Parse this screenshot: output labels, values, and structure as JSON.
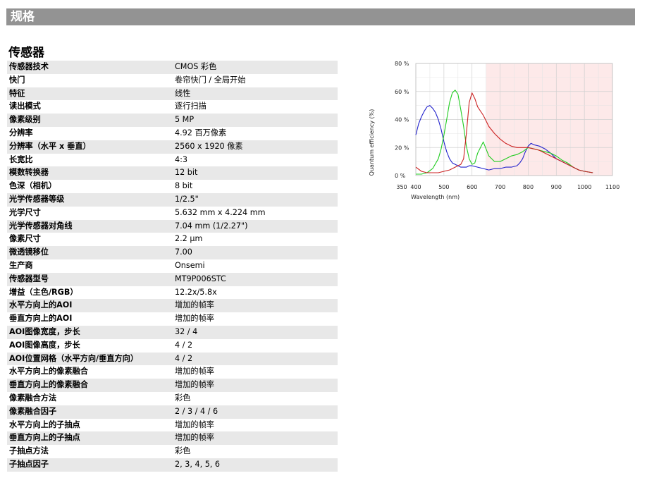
{
  "header": {
    "title": "规格"
  },
  "section": {
    "title": "传感器"
  },
  "specs": [
    {
      "key": "传感器技术",
      "value": "CMOS 彩色"
    },
    {
      "key": "快门",
      "value": "卷帘快门 / 全局开始"
    },
    {
      "key": "特征",
      "value": "线性"
    },
    {
      "key": "读出模式",
      "value": "逐行扫描"
    },
    {
      "key": "像素级别",
      "value": "5 MP"
    },
    {
      "key": "分辨率",
      "value": "4.92 百万像素"
    },
    {
      "key": "分辨率（水平 x 垂直）",
      "value": "2560 x 1920 像素"
    },
    {
      "key": "长宽比",
      "value": "4:3"
    },
    {
      "key": "模数转换器",
      "value": "12 bit"
    },
    {
      "key": "色深（相机）",
      "value": "8 bit"
    },
    {
      "key": "光学传感器等级",
      "value": "1/2.5\""
    },
    {
      "key": "光学尺寸",
      "value": "5.632 mm x 4.224 mm"
    },
    {
      "key": "光学传感器对角线",
      "value": "7.04 mm (1/2.27\")"
    },
    {
      "key": "像素尺寸",
      "value": "2.2 µm"
    },
    {
      "key": "微透镜移位",
      "value": "7.00"
    },
    {
      "key": "生产商",
      "value": "Onsemi"
    },
    {
      "key": "传感器型号",
      "value": "MT9P006STC"
    },
    {
      "key": "增益（主色/RGB）",
      "value": "12.2x/5.8x"
    },
    {
      "key": "水平方向上的AOI",
      "value": "增加的帧率"
    },
    {
      "key": "垂直方向上的AOI",
      "value": "增加的帧率"
    },
    {
      "key": "AOI图像宽度，步长",
      "value": "32 / 4"
    },
    {
      "key": "AOI图像高度，步长",
      "value": "4 / 2"
    },
    {
      "key": "AOI位置网格（水平方向/垂直方向）",
      "value": "4 / 2"
    },
    {
      "key": "水平方向上的像素融合",
      "value": "增加的帧率"
    },
    {
      "key": "垂直方向上的像素融合",
      "value": "增加的帧率"
    },
    {
      "key": "像素融合方法",
      "value": "彩色"
    },
    {
      "key": "像素融合因子",
      "value": "2 / 3 / 4 / 6"
    },
    {
      "key": "水平方向上的子抽点",
      "value": "增加的帧率"
    },
    {
      "key": "垂直方向上的子抽点",
      "value": "增加的帧率"
    },
    {
      "key": "子抽点方法",
      "value": "彩色"
    },
    {
      "key": "子抽点因子",
      "value": "2, 3, 4, 5, 6"
    }
  ],
  "chart_data": {
    "type": "line",
    "title": "",
    "xlabel": "Wavelength (nm)",
    "ylabel": "Quantum efficiency (%)",
    "xlim": [
      350,
      1100
    ],
    "ylim": [
      0,
      80
    ],
    "x_ticks": [
      350,
      400,
      500,
      600,
      700,
      800,
      900,
      1000,
      1100
    ],
    "x_tick_labels": [
      "350",
      "400",
      "500",
      "600",
      "700",
      "800",
      "900",
      "1000",
      "1100"
    ],
    "y_ticks": [
      0,
      20,
      40,
      60,
      80
    ],
    "y_tick_labels": [
      "0 %",
      "20 %",
      "40 %",
      "60 %",
      "80 %"
    ],
    "grid": true,
    "plot_area_x": [
      400,
      1100
    ],
    "highlight_region": {
      "x": [
        650,
        1100
      ],
      "color": "#fde9e9"
    },
    "series": [
      {
        "color": "#2222cc",
        "x": [
          400,
          410,
          420,
          430,
          440,
          450,
          460,
          470,
          480,
          490,
          500,
          510,
          520,
          530,
          540,
          550,
          560,
          570,
          580,
          590,
          600,
          620,
          640,
          660,
          680,
          700,
          720,
          740,
          760,
          770,
          780,
          790,
          800,
          810,
          820,
          840,
          860,
          880,
          900,
          920,
          940,
          960,
          980,
          1000,
          1030
        ],
        "y": [
          29,
          37,
          42,
          46,
          49,
          50,
          48,
          45,
          40,
          33,
          24,
          17,
          12,
          9,
          8,
          7,
          6,
          6,
          6,
          7,
          7,
          6,
          5,
          4,
          5,
          5,
          6,
          6,
          7,
          9,
          12,
          17,
          21,
          23,
          22,
          21,
          19,
          16,
          12,
          10,
          8,
          6,
          4,
          3,
          2
        ]
      },
      {
        "color": "#22cc22",
        "x": [
          400,
          420,
          440,
          460,
          480,
          490,
          500,
          510,
          520,
          530,
          540,
          550,
          560,
          570,
          580,
          590,
          600,
          610,
          620,
          640,
          660,
          680,
          700,
          720,
          740,
          760,
          780,
          800,
          820,
          840,
          860,
          880,
          900,
          920,
          940,
          960,
          980,
          1000,
          1030
        ],
        "y": [
          1,
          1,
          2,
          5,
          12,
          19,
          29,
          40,
          52,
          59,
          61,
          58,
          47,
          35,
          21,
          12,
          8,
          9,
          16,
          24,
          14,
          10,
          10,
          12,
          14,
          15,
          17,
          20,
          19,
          18,
          17,
          16,
          14,
          11,
          9,
          6,
          4,
          3,
          2
        ]
      },
      {
        "color": "#cc2222",
        "x": [
          400,
          420,
          440,
          460,
          480,
          500,
          520,
          540,
          560,
          570,
          580,
          590,
          600,
          610,
          620,
          640,
          660,
          680,
          700,
          720,
          740,
          760,
          780,
          800,
          820,
          840,
          860,
          880,
          900,
          920,
          940,
          960,
          980,
          1000,
          1030
        ],
        "y": [
          6,
          3,
          2,
          2,
          2,
          3,
          4,
          6,
          8,
          12,
          30,
          52,
          59,
          55,
          49,
          43,
          35,
          30,
          26,
          23,
          21,
          20,
          20,
          20,
          19,
          18,
          16,
          14,
          12,
          10,
          8,
          6,
          4,
          3,
          2
        ]
      }
    ]
  }
}
